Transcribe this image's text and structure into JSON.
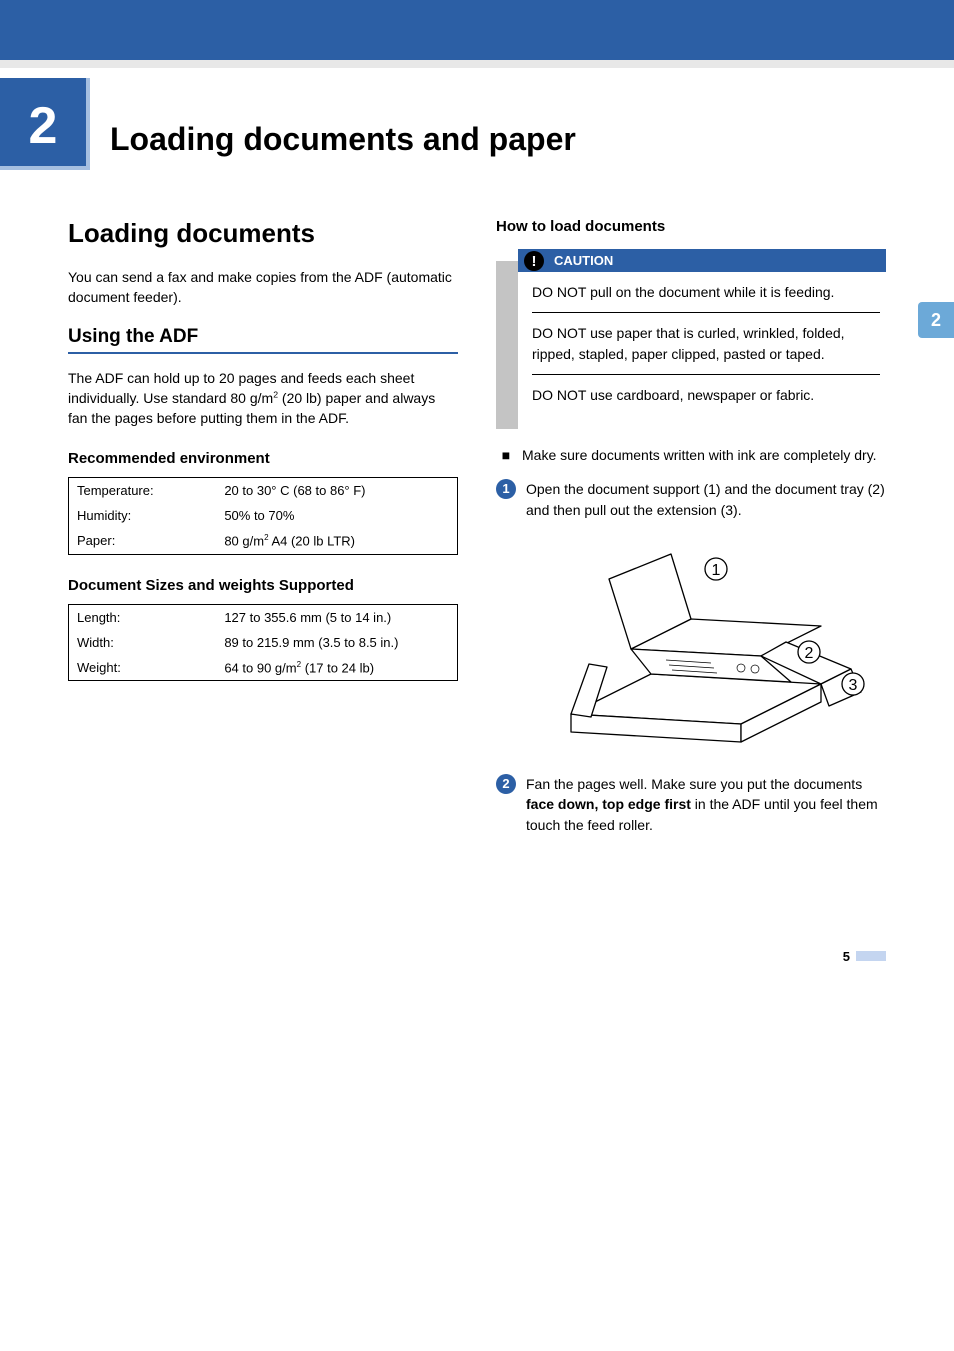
{
  "chapter": {
    "number": "2",
    "title": "Loading documents and paper"
  },
  "sideTab": "2",
  "section": {
    "title": "Loading documents",
    "intro": "You can send a fax and make copies from the ADF (automatic document feeder)."
  },
  "sub_adf": {
    "title": "Using the ADF",
    "desc_before_sup": "The ADF can hold up to 20 pages and feeds each sheet individually. Use standard 80 g/m",
    "desc_after_sup": " (20 lb) paper and always fan the pages before putting them in the ADF."
  },
  "env": {
    "title": "Recommended environment",
    "rows": [
      {
        "label": "Temperature:",
        "value": "20 to 30° C (68 to 86° F)"
      },
      {
        "label": "Humidity:",
        "value": "50% to 70%"
      },
      {
        "label": "Paper:",
        "value_pre": "80 g/m",
        "value_post": " A4 (20 lb LTR)"
      }
    ]
  },
  "sizes": {
    "title": "Document Sizes and weights Supported",
    "rows": [
      {
        "label": "Length:",
        "value": "127 to 355.6 mm (5 to 14 in.)"
      },
      {
        "label": "Width:",
        "value": "89 to 215.9 mm (3.5 to 8.5 in.)"
      },
      {
        "label": "Weight:",
        "value_pre": "64 to 90 g/m",
        "value_post": " (17 to 24 lb)"
      }
    ]
  },
  "howto": {
    "title": "How to load documents",
    "caution_label": "CAUTION",
    "cautions": [
      "DO NOT pull on the document while it is feeding.",
      "DO NOT use paper that is curled, wrinkled, folded, ripped, stapled, paper clipped, pasted or taped.",
      "DO NOT use cardboard, newspaper or fabric."
    ],
    "bullet": "Make sure documents written with ink are completely dry.",
    "steps": [
      {
        "num": "1",
        "text": "Open the document support (1) and the document tray (2) and then pull out the extension (3)."
      },
      {
        "num": "2",
        "text_pre": "Fan the pages well. Make sure you put the documents ",
        "bold": "face down, top edge first",
        "text_post": " in the ADF until you feel them touch the feed roller."
      }
    ]
  },
  "illustration": {
    "labels": {
      "one": "1",
      "two": "2",
      "three": "3"
    }
  },
  "pageNumber": "5"
}
